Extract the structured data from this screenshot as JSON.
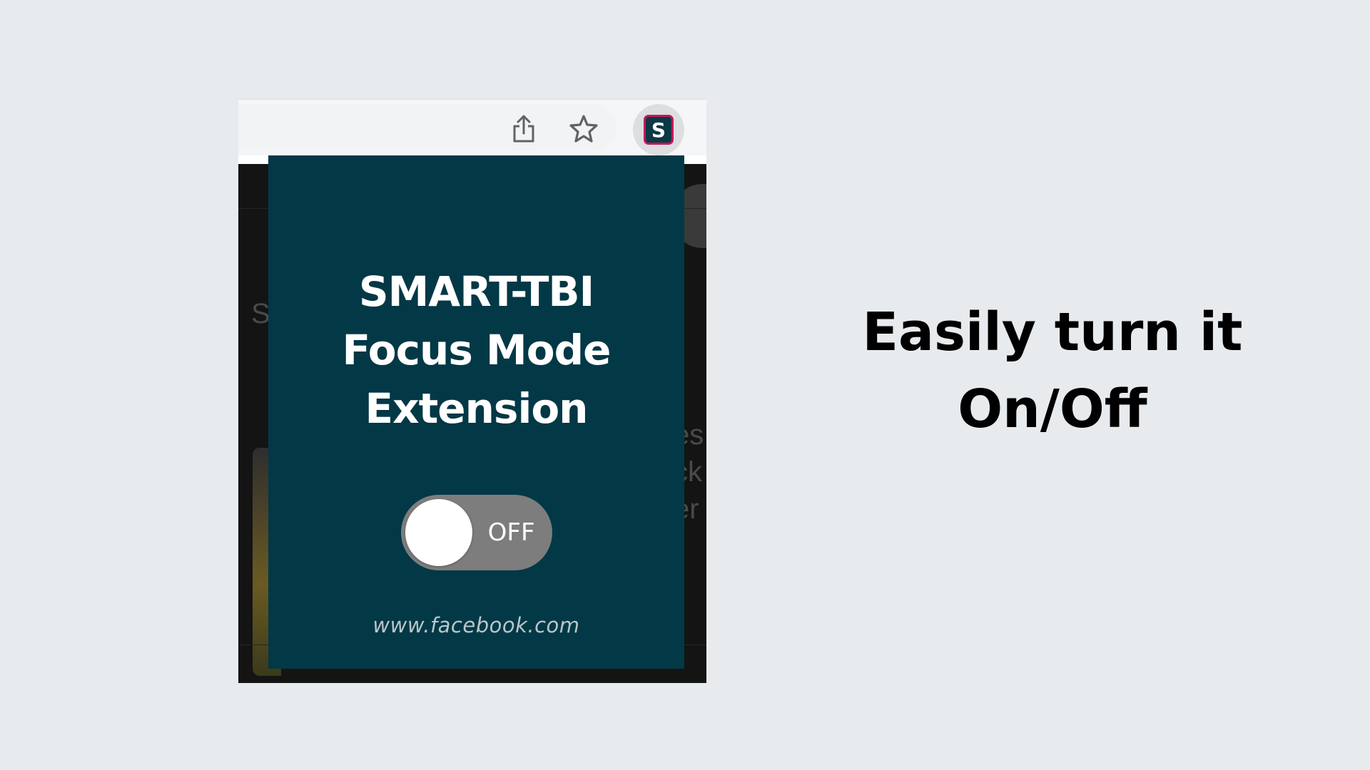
{
  "toolbar": {
    "share_icon": "share-icon",
    "bookmark_icon": "star-icon",
    "extension_letter": "S"
  },
  "popup": {
    "title_line1": "SMART-TBI",
    "title_line2": "Focus Mode",
    "title_line3": "Extension",
    "toggle_label": "OFF",
    "toggle_state": "off",
    "site": "www.facebook.com",
    "background_color": "#033846"
  },
  "caption": {
    "line1": "Easily turn it",
    "line2": "On/Off"
  }
}
